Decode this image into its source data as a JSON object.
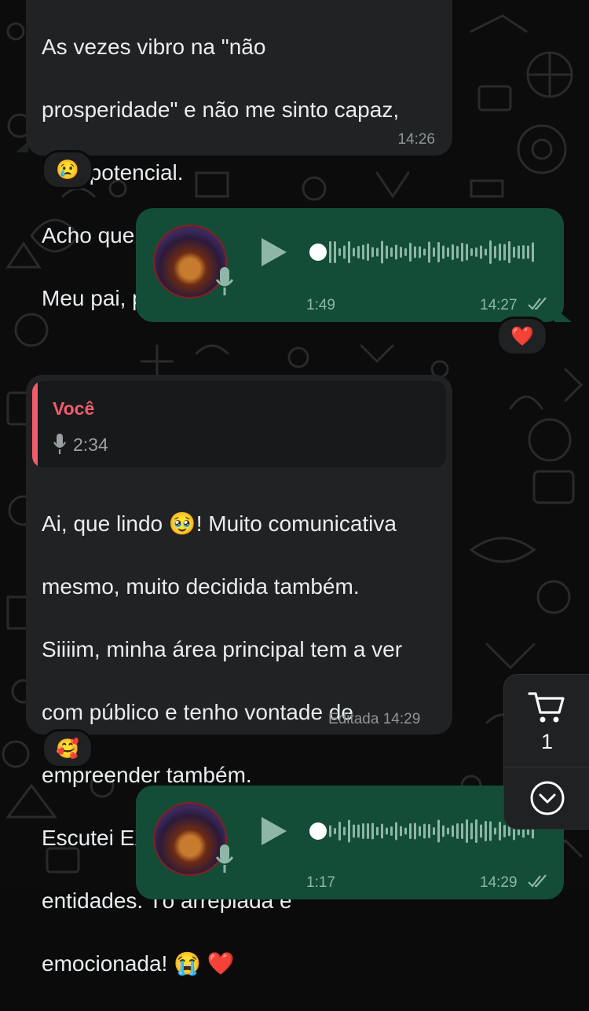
{
  "colors": {
    "incoming_bubble": "#202223",
    "outgoing_bubble": "#134d37",
    "quote_accent": "#f15c6d",
    "meta_text": "#8e9597"
  },
  "messages": [
    {
      "type": "text",
      "direction": "incoming",
      "text": "As vezes vibro na \"não prosperidade\" e não me sinto capaz, sem potencial.\nAcho que vem da ancestralidade...\nMeu pai, principalmente.",
      "line1": "As vezes vibro na \"não",
      "line2": "prosperidade\" e não me sinto capaz,",
      "line3": "sem potencial.",
      "line4": "Acho que vem da ancestralidade...",
      "line5": "Meu pai, principalmente.",
      "time": "14:26",
      "reaction": "😢"
    },
    {
      "type": "voice",
      "direction": "outgoing",
      "duration": "1:49",
      "time": "14:27",
      "status": "read",
      "status_icon": "double-check-icon",
      "reaction": "❤️"
    },
    {
      "type": "text",
      "direction": "incoming",
      "quote": {
        "author": "Você",
        "icon": "mic-icon",
        "duration": "2:34"
      },
      "line1": "Ai, que lindo 🥹! Muito comunicativa",
      "line2": "mesmo, muito decidida também.",
      "line3": "Siiiim, minha área principal tem a ver",
      "line4": "com público e tenho vontade de",
      "line5": "empreender também.",
      "line6": "Escutei EXATAMENTE isso de várias",
      "line7": "entidades. Tô arrepiada e",
      "line8": "emocionada! 😭 ❤️",
      "edited_label": "Editada",
      "time": "14:29",
      "reaction": "🥰"
    },
    {
      "type": "voice",
      "direction": "outgoing",
      "duration": "1:17",
      "time": "14:29",
      "status": "read",
      "status_icon": "double-check-icon"
    }
  ],
  "floating_actions": {
    "cart_icon": "cart-icon",
    "cart_count": "1",
    "scroll_icon": "chevron-down-circle-icon"
  }
}
